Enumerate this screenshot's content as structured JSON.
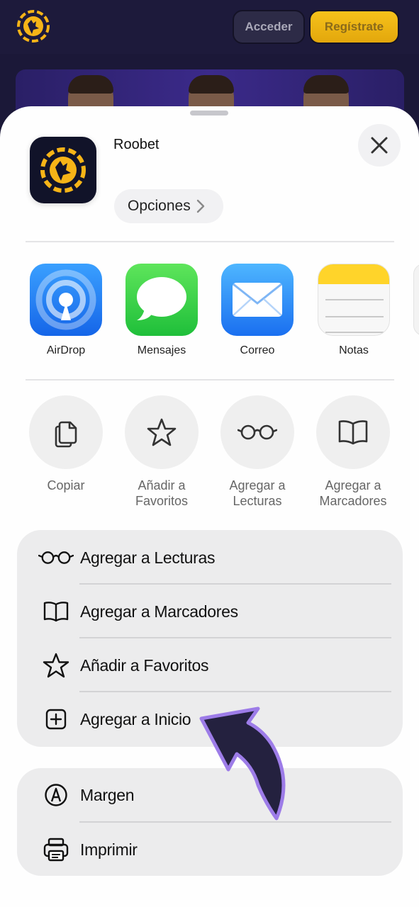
{
  "site": {
    "login_label": "Acceder",
    "register_label": "Regístrate",
    "colors": {
      "header_bg": "#1d1a3b",
      "accent": "#f6b417",
      "banner": "#3b2a8a"
    }
  },
  "sheet": {
    "app_name": "Roobet",
    "options_label": "Opciones",
    "apps": [
      {
        "label": "AirDrop",
        "icon": "airdrop-icon"
      },
      {
        "label": "Mensajes",
        "icon": "messages-icon"
      },
      {
        "label": "Correo",
        "icon": "mail-icon"
      },
      {
        "label": "Notas",
        "icon": "notes-icon"
      }
    ],
    "actions": [
      {
        "label": "Copiar",
        "icon": "copy-icon"
      },
      {
        "label": "Añadir a Favoritos",
        "icon": "star-icon"
      },
      {
        "label": "Agregar a Lecturas",
        "icon": "glasses-icon"
      },
      {
        "label": "Agregar a Marcadores",
        "icon": "book-icon"
      }
    ],
    "list_primary": [
      {
        "label": "Agregar a Lecturas",
        "icon": "glasses-icon"
      },
      {
        "label": "Agregar a Marcadores",
        "icon": "book-icon"
      },
      {
        "label": "Añadir a Favoritos",
        "icon": "star-icon"
      },
      {
        "label": "Agregar a Inicio",
        "icon": "add-square-icon"
      }
    ],
    "list_secondary": [
      {
        "label": "Margen",
        "icon": "markup-icon"
      },
      {
        "label": "Imprimir",
        "icon": "printer-icon"
      }
    ]
  }
}
